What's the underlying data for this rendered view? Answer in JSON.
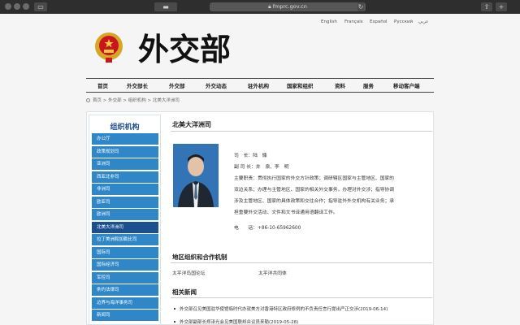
{
  "browser": {
    "url": "fmprc.gov.cn"
  },
  "languages": [
    "English",
    "Français",
    "Español",
    "Русский",
    "عربي"
  ],
  "header": {
    "logo_text": "外交部"
  },
  "nav": [
    "首页",
    "外交部长",
    "外交部",
    "外交动态",
    "驻外机构",
    "国家和组织",
    "资料",
    "服务",
    "移动客户端"
  ],
  "breadcrumb": "首页 > 外交部 > 组织机构 > 北美大洋洲司",
  "sidebar": {
    "title": "组织机构",
    "items": [
      "办公厅",
      "政策规划司",
      "亚洲司",
      "西亚北非司",
      "非洲司",
      "欧亚司",
      "欧洲司",
      "北美大洋洲司",
      "拉丁美洲和加勒比司",
      "国际司",
      "国际经济司",
      "军控司",
      "条约法律司",
      "边界与海洋事务司",
      "新闻司"
    ],
    "active_index": 7
  },
  "main": {
    "title": "北美大洋洲司",
    "director": "司　长：陆　慷",
    "deputy": "副 司 长：井　泉、李　明",
    "duties": [
      "主要职责：贯彻执行国家的外交方针政策；调研辖区国家与主管地区、国家的",
      "双边关系；办理与主管地区、国家的相关外交事务，办理对外交涉；指导协调",
      "涉及主管地区、国家的具体政策和交往合作；指导驻外外交机构有关业务；承",
      "担重要外交活动、文件和文书译通用语翻译工作。"
    ],
    "phone": "电　　话：+86-10-65962600"
  },
  "regional_orgs": {
    "title": "地区组织和合作机制",
    "items": [
      "太平洋岛国论坛",
      "太平洋共同体"
    ]
  },
  "news": {
    "title": "相关新闻",
    "items": [
      "外交部召见美国驻华使馆临时代办就美方对香港特区政府修例的不负责任言行提出严正交涉(2019-06-14)",
      "外交部副部长郑泽光会见美国联邦众议员来勒(2019-05-28)"
    ]
  }
}
